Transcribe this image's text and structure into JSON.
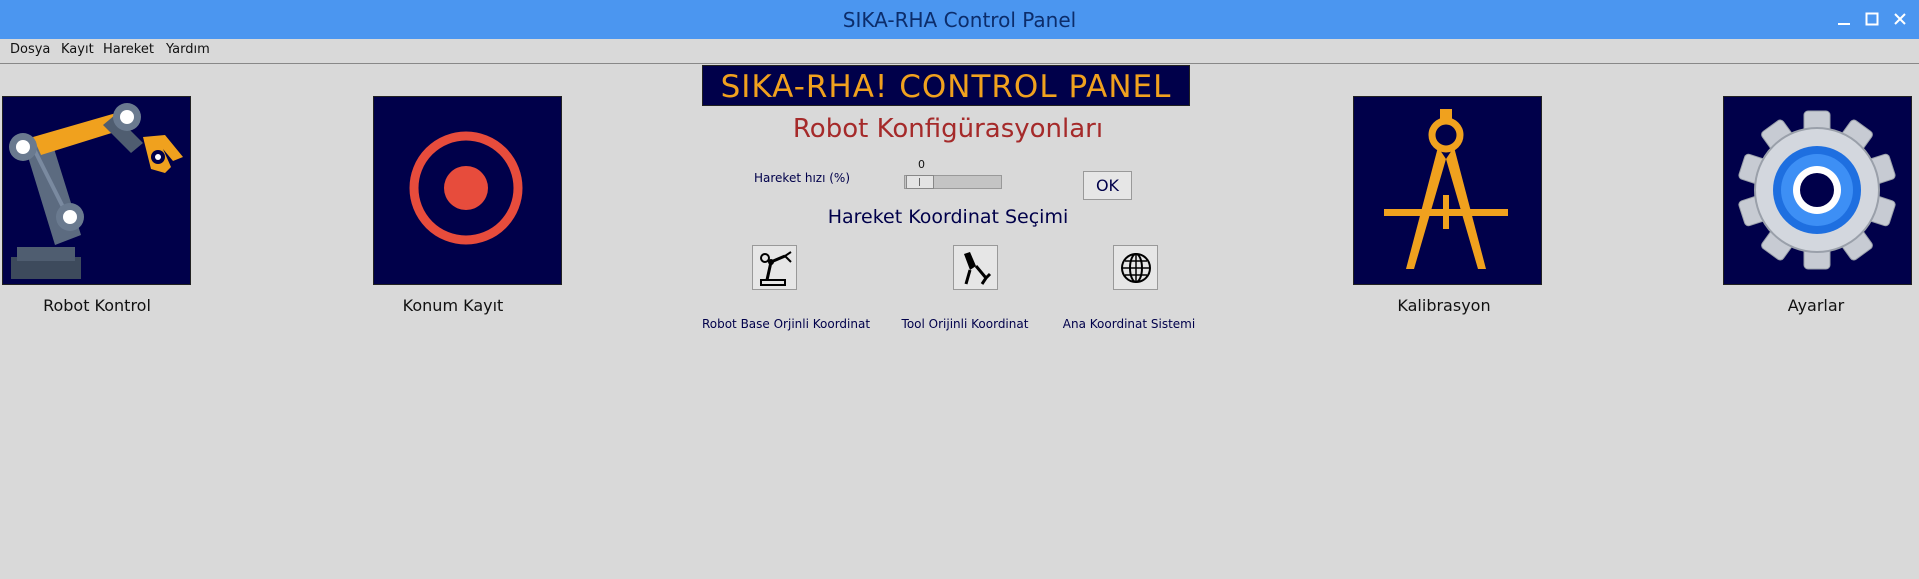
{
  "window": {
    "title": "SIKA-RHA Control Panel"
  },
  "menu": [
    "Dosya",
    "Kayıt",
    "Hareket",
    "Yardım"
  ],
  "nav": {
    "robot_control": "Robot Kontrol",
    "position_record": "Konum Kayıt",
    "calibration": "Kalibrasyon",
    "settings": "Ayarlar"
  },
  "panel": {
    "banner": "SIKA-RHA! CONTROL PANEL",
    "config_title": "Robot Konfigürasyonları",
    "speed_label": "Hareket hızı  (%)",
    "speed_value": "0",
    "ok_label": "OK",
    "coord_title": "Hareket Koordinat Seçimi",
    "coords": {
      "base": "Robot Base Orjinli Koordinat",
      "tool": "Tool Orijinli Koordinat",
      "world": "Ana Koordinat Sistemi"
    }
  },
  "colors": {
    "titlebar": "#4b96f0",
    "tile_bg": "#00004a",
    "banner_text": "#f0a11e",
    "config_title": "#a52a2a",
    "record": "#e74c3c"
  }
}
